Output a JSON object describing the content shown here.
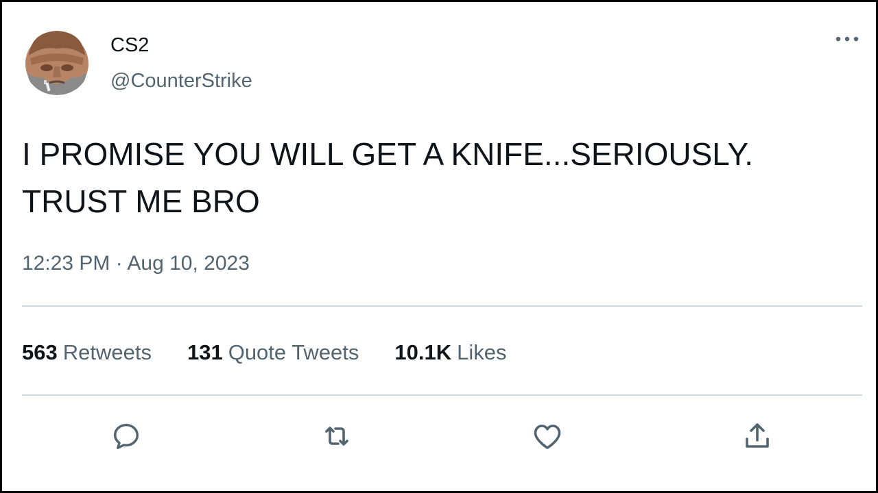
{
  "author": {
    "display_name": "CS2",
    "handle": "@CounterStrike",
    "avatar_icon": "cs-character-avatar"
  },
  "tweet": {
    "line1": "I PROMISE YOU WILL GET A KNIFE...SERIOUSLY.",
    "line2": "TRUST ME BRO",
    "timestamp": "12:23 PM · Aug 10, 2023"
  },
  "stats": {
    "retweets": {
      "count": "563",
      "label": "Retweets"
    },
    "quotes": {
      "count": "131",
      "label": "Quote Tweets"
    },
    "likes": {
      "count": "10.1K",
      "label": "Likes"
    }
  },
  "actions": {
    "icons": [
      "reply-icon",
      "retweet-icon",
      "like-icon",
      "share-icon"
    ]
  },
  "menu": {
    "icon": "more-options-icon"
  },
  "colors": {
    "text_primary": "#0f1419",
    "text_secondary": "#536471",
    "divider": "#cfd9de",
    "icon_accent": "#536471"
  }
}
